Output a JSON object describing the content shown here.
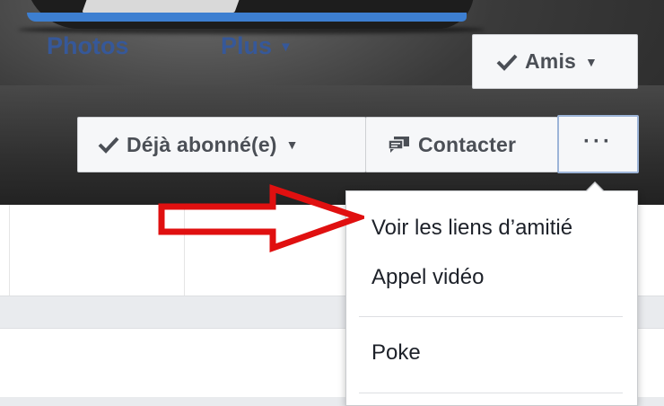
{
  "cover": {
    "amis_label": "Amis",
    "subscribed_label": "Déjà abonné(e)",
    "contact_label": "Contacter",
    "more_label": "···"
  },
  "nav": {
    "photos_label": "Photos",
    "plus_label": "Plus"
  },
  "menu": {
    "items": [
      {
        "label": "Voir les liens d’amitié"
      },
      {
        "label": "Appel vidéo"
      },
      {
        "label": "Poke"
      }
    ]
  },
  "icons": {
    "check": "check-icon",
    "caret": "caret-down-icon",
    "message": "message-icon",
    "more": "more-dots-icon",
    "arrow": "red-arrow-annotation"
  },
  "colors": {
    "link_blue": "#365899",
    "button_text": "#4b4f56",
    "annotation_red": "#e01010",
    "focus_border": "#9cb4d8"
  }
}
